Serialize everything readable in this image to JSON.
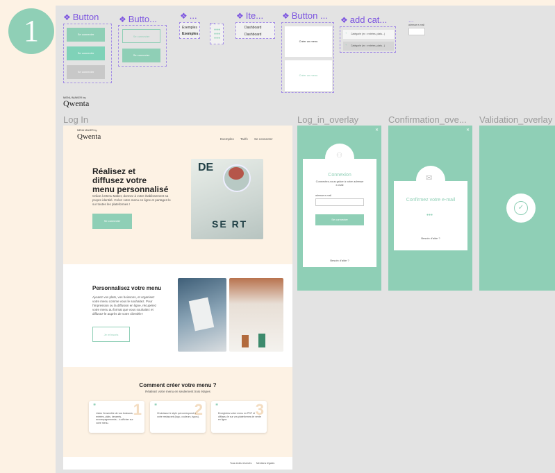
{
  "badge": {
    "number": "1"
  },
  "components": {
    "button1": {
      "title": "Button",
      "labels": [
        "Se connecter",
        "Se connecter",
        "Se connecter"
      ]
    },
    "button2": {
      "title": "Butto...",
      "labels": [
        "Se connecter",
        "Se connecter"
      ]
    },
    "comp3": {
      "title": "...",
      "items": [
        "Exemples",
        "Exemples"
      ]
    },
    "comp4": {
      "title": "..."
    },
    "item": {
      "title": "Ite...",
      "items": [
        "Dashboard",
        "Dashboard"
      ]
    },
    "button3": {
      "title": "Button ...",
      "labels": [
        "Créer un menu",
        "Créer un menu"
      ]
    },
    "addcat": {
      "title": "add cat...",
      "items": [
        "Catégorie (ex : entrées, plats...)",
        "Catégorie (ex : entrées, plats...)"
      ]
    },
    "comp8": {
      "title": "...",
      "field": "adresse e-mail"
    }
  },
  "logo": {
    "small": "MENU MAKER by",
    "brand": "Qwenta"
  },
  "frames": {
    "login": "Log In",
    "login_overlay": "Log_in_overlay",
    "confirmation_overlay": "Confirmation_ove...",
    "validation_overlay": "Validation_overlay"
  },
  "landing": {
    "nav": [
      "Exemples",
      "Tarifs",
      "Se connecter"
    ],
    "hero_title": "Réalisez et diffusez votre menu personnalisé",
    "hero_text": "Grâce à Menu Maker, donnez à votre établissement sa propre identité. Créez votre menu en ligne et partagez-le sur toutes les plateformes !",
    "hero_button": "Se connecter",
    "section2_title": "Personnalisez votre menu",
    "section2_text": "Ajoutez vos plats, vos boissons, et organisez votre menu comme vous le souhaitez. Pour l'impression ou la diffusion en ligne, récupérez votre menu au format que vous souhaitez et diffusez-le auprès de votre clientèle !",
    "section2_button": "Je m'inscris",
    "section3_title": "Comment créer votre menu ?",
    "section3_subtitle": "Réalisez votre menu en seulement trois étapes",
    "steps": [
      {
        "num": "1",
        "text": "Listez l'ensemble de vos boissons, entrées, plats, desserts, accompagnements... à afficher sur votre menu."
      },
      {
        "num": "2",
        "text": "Choisissez le style qui correspond à votre restaurant (logo, couleurs, typos)."
      },
      {
        "num": "3",
        "text": "Enregistrez votre menu en PDF et diffusez-le sur vos plateformes de vente en ligne."
      }
    ],
    "footer": [
      "Tous droits réservés",
      "Mentions légales"
    ]
  },
  "login_modal": {
    "title": "Connexion",
    "text": "Connectez-vous grâce à votre adresse e-mail",
    "field_label": "adresse e-mail",
    "button": "Se connecter",
    "help": "Besoin d'aide ?"
  },
  "confirm_modal": {
    "title": "Confirmez votre e-mail",
    "help": "Besoin d'aide ?"
  },
  "colors": {
    "accent": "#8fcfb6",
    "cream": "#fdf2e4",
    "purple": "#7b53e0",
    "canvas": "#e3e3e3"
  }
}
